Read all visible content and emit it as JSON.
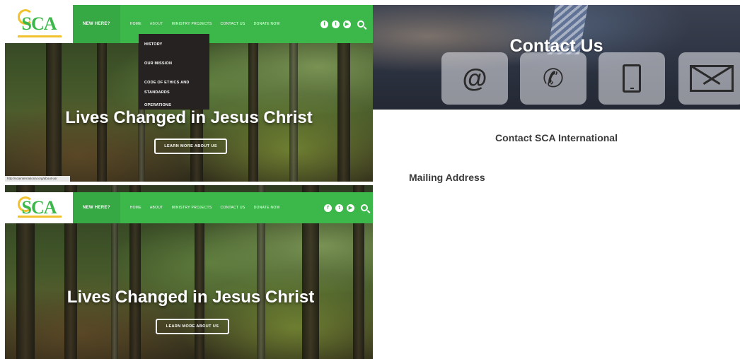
{
  "brand": {
    "logo_text": "SCA",
    "accent_color": "#3cb84a",
    "gold_color": "#f2c12e"
  },
  "header": {
    "new_here": "NEW HERE?",
    "nav": [
      "HOME",
      "ABOUT",
      "MINISTRY PROJECTS",
      "CONTACT US",
      "DONATE NOW"
    ],
    "social_icons": [
      "facebook-icon",
      "twitter-icon",
      "youtube-icon",
      "search-icon"
    ]
  },
  "dropdown": {
    "items": [
      "HISTORY",
      "OUR MISSION",
      "CODE OF ETHICS AND STANDARDS",
      "OPERATIONS"
    ]
  },
  "hero": {
    "title": "Lives Changed in Jesus Christ",
    "button": "LEARN MORE ABOUT US"
  },
  "status_bar": {
    "url": "http://scainternational.org/about-us/"
  },
  "contact": {
    "title": "Contact Us",
    "subtitle": "Contact SCA International",
    "mailing": "Mailing Address",
    "tile_icons": [
      "at-icon",
      "phone-icon",
      "tablet-icon",
      "mail-icon"
    ]
  }
}
